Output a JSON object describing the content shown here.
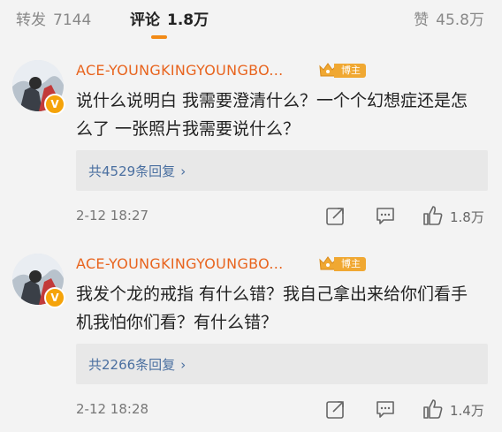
{
  "tabs": {
    "repost": {
      "label": "转发",
      "count": "7144"
    },
    "comment": {
      "label": "评论",
      "count": "1.8万"
    },
    "like": {
      "label": "赞",
      "count": "45.8万"
    }
  },
  "comments": [
    {
      "username": "ACE-YOUNGKINGYOUNGBO...",
      "badge": "博主",
      "text": "说什么说明白 我需要澄清什么？一个个幻想症还是怎么了 一张照片我需要说什么？",
      "replies": "共4529条回复",
      "time": "2-12 18:27",
      "likes": "1.8万"
    },
    {
      "username": "ACE-YOUNGKINGYOUNGBO...",
      "badge": "博主",
      "text": "我发个龙的戒指 有什么错？我自己拿出来给你们看手机我怕你们看？有什么错？",
      "replies": "共2266条回复",
      "time": "2-12 18:28",
      "likes": "1.4万"
    }
  ],
  "colors": {
    "accent": "#f28a16",
    "username": "#e8641e",
    "link": "#4a6fa0",
    "badge": "#f0a832"
  },
  "icons": [
    "verified-v-icon",
    "crown-icon",
    "chevron-right-icon",
    "share-icon",
    "comment-icon",
    "thumbs-up-icon"
  ]
}
